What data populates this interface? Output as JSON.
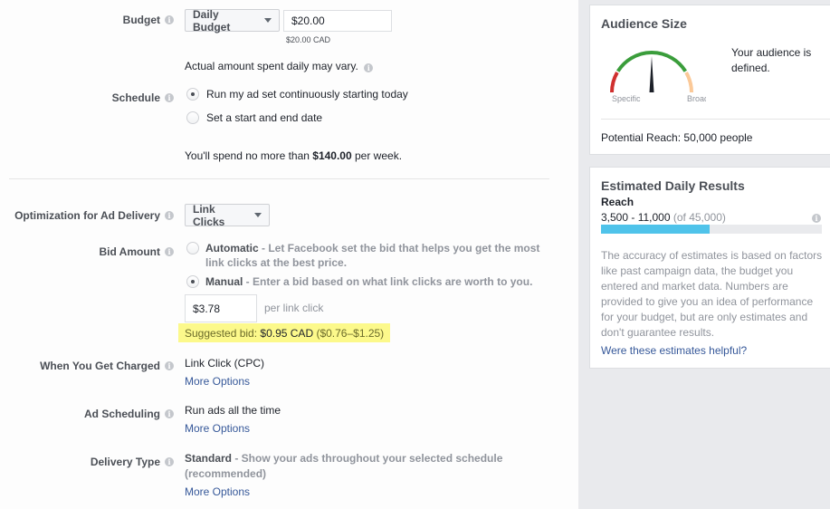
{
  "budget": {
    "label": "Budget",
    "type_dropdown": "Daily Budget",
    "amount_value": "$20.00",
    "amount_converted": "$20.00 CAD",
    "note": "Actual amount spent daily may vary."
  },
  "schedule": {
    "label": "Schedule",
    "options": [
      {
        "label": "Run my ad set continuously starting today",
        "selected": true
      },
      {
        "label": "Set a start and end date",
        "selected": false
      }
    ],
    "spend_prefix": "You'll spend no more than ",
    "spend_amount": "$140.00",
    "spend_suffix": " per week."
  },
  "optimization": {
    "label": "Optimization for Ad Delivery",
    "dropdown": "Link Clicks"
  },
  "bid": {
    "label": "Bid Amount",
    "automatic_title": "Automatic",
    "automatic_desc_line1": " - Let Facebook set the bid that helps you get the most",
    "automatic_desc_line2": "link clicks at the best price.",
    "automatic_selected": false,
    "manual_title": "Manual",
    "manual_desc": " - Enter a bid based on what link clicks are worth to you.",
    "manual_selected": true,
    "amount_value": "$3.78",
    "amount_unit": "per link click",
    "suggested_prefix": "Suggested bid: ",
    "suggested_value": "$0.95 CAD",
    "suggested_range": " ($0.76–$1.25)"
  },
  "charged": {
    "label": "When You Get Charged",
    "value": "Link Click (CPC)",
    "more_options": "More Options"
  },
  "ad_scheduling": {
    "label": "Ad Scheduling",
    "value": "Run ads all the time",
    "more_options": "More Options"
  },
  "delivery_type": {
    "label": "Delivery Type",
    "title": "Standard",
    "desc_line1": " - Show your ads throughout your selected schedule",
    "desc_line2": "(recommended)",
    "more_options": "More Options"
  },
  "audience_size": {
    "title": "Audience Size",
    "gauge_low_label": "Specific",
    "gauge_high_label": "Broad",
    "gauge_position": 0.5,
    "status": "Your audience is defined.",
    "status_line1": "Your audience is",
    "status_line2": "defined.",
    "potential_reach": "Potential Reach: 50,000 people",
    "colors": {
      "low": "#d0302f",
      "mid": "#3a9d3b",
      "high": "#fbc998",
      "needle": "#1d2129"
    }
  },
  "daily_results": {
    "title": "Estimated Daily Results",
    "metric": "Reach",
    "range": "3,500 - 11,000",
    "total": " (of 45,000)",
    "progress_fraction": 0.49,
    "progress_color": "#4fc3ea",
    "disclaimer_lines": [
      "The accuracy of estimates is based on factors",
      "like past campaign data, the budget you",
      "entered and market data. Numbers are",
      "provided to give you an idea of performance",
      "for your budget, but are only estimates and",
      "don't guarantee results."
    ],
    "feedback_link": "Were these estimates helpful?"
  }
}
